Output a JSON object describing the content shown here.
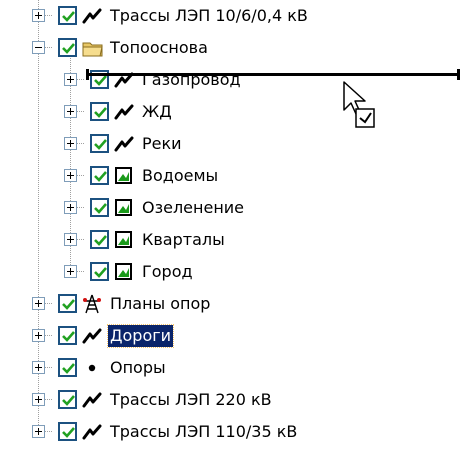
{
  "tree": {
    "items": [
      {
        "label": "Трассы ЛЭП 10/6/0,4 кВ",
        "icon": "line-layer-icon",
        "level": 0,
        "expanded": false,
        "checked": true,
        "selected": false
      },
      {
        "label": "Топооснова",
        "icon": "folder-icon",
        "level": 0,
        "expanded": true,
        "checked": true,
        "selected": false
      },
      {
        "label": "Газопровод",
        "icon": "line-layer-icon",
        "level": 1,
        "expanded": false,
        "checked": true,
        "selected": false
      },
      {
        "label": "ЖД",
        "icon": "line-layer-icon",
        "level": 1,
        "expanded": false,
        "checked": true,
        "selected": false
      },
      {
        "label": "Реки",
        "icon": "line-layer-icon",
        "level": 1,
        "expanded": false,
        "checked": true,
        "selected": false
      },
      {
        "label": "Водоемы",
        "icon": "polygon-layer-icon",
        "level": 1,
        "expanded": false,
        "checked": true,
        "selected": false
      },
      {
        "label": "Озеленение",
        "icon": "polygon-layer-icon",
        "level": 1,
        "expanded": false,
        "checked": true,
        "selected": false
      },
      {
        "label": "Кварталы",
        "icon": "polygon-layer-icon",
        "level": 1,
        "expanded": false,
        "checked": true,
        "selected": false
      },
      {
        "label": "Город",
        "icon": "polygon-layer-icon",
        "level": 1,
        "expanded": false,
        "checked": true,
        "selected": false
      },
      {
        "label": "Планы опор",
        "icon": "tower-layer-icon",
        "level": 0,
        "expanded": false,
        "checked": true,
        "selected": false
      },
      {
        "label": "Дороги",
        "icon": "line-layer-icon",
        "level": 0,
        "expanded": false,
        "checked": true,
        "selected": true
      },
      {
        "label": "Опоры",
        "icon": "point-layer-icon",
        "level": 0,
        "expanded": false,
        "checked": true,
        "selected": false
      },
      {
        "label": "Трассы ЛЭП 220 кВ",
        "icon": "line-layer-icon",
        "level": 0,
        "expanded": false,
        "checked": true,
        "selected": false
      },
      {
        "label": "Трассы ЛЭП 110/35 кВ",
        "icon": "line-layer-icon",
        "level": 0,
        "expanded": false,
        "checked": true,
        "selected": false
      }
    ]
  },
  "drag": {
    "cursor_icon": "drag-copy-cursor-icon",
    "drop_indicator": "drop-insert-line"
  },
  "colors": {
    "selection_bg": "#0a246a",
    "selection_text": "#ffffff",
    "check": "#21a121",
    "checkbox_border": "#1c5180"
  }
}
